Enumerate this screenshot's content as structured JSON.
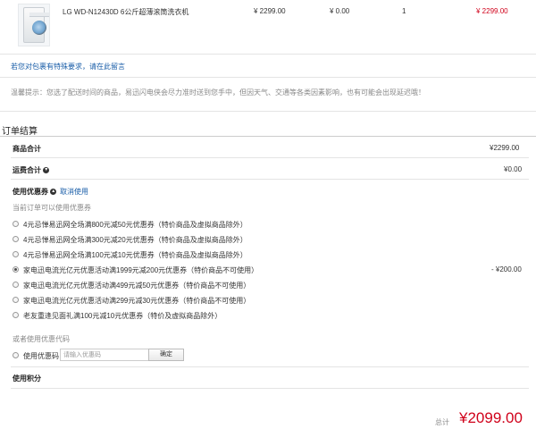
{
  "product": {
    "name": "LG WD-N12430D 6公斤超薄滚筒洗衣机",
    "unit_price": "¥ 2299.00",
    "discount": "¥ 0.00",
    "quantity": "1",
    "subtotal": "¥ 2299.00"
  },
  "packaging_note_link": "若您对包裹有特殊要求，请在此留言",
  "warm_tip": "温馨提示：您选了配送时间的商品，易迅闪电侠会尽力准时送到您手中，但因天气、交通等各类因素影响，也有可能会出现延迟哦！",
  "settlement": {
    "title": "订单结算",
    "goods_total_label": "商品合计",
    "goods_total_value": "¥2299.00",
    "shipping_label": "运费合计",
    "shipping_value": "¥0.00"
  },
  "coupons": {
    "label": "使用优惠券",
    "cancel_link": "取消使用",
    "available_note": "当前订单可以使用优惠券",
    "items": [
      {
        "label": "4元忌惮易迅网全场满800元减50元优惠券（特价商品及虚拟商品除外）",
        "checked": false,
        "amount": ""
      },
      {
        "label": "4元忌惮易迅网全场满300元减20元优惠券（特价商品及虚拟商品除外）",
        "checked": false,
        "amount": ""
      },
      {
        "label": "4元忌惮易迅网全场满100元减10元优惠券（特价商品及虚拟商品除外）",
        "checked": false,
        "amount": ""
      },
      {
        "label": "家电迅电流光亿元优惠活动满1999元减200元优惠券（特价商品不可使用）",
        "checked": true,
        "amount": "- ¥200.00"
      },
      {
        "label": "家电迅电流光亿元优惠活动满499元减50元优惠券（特价商品不可使用）",
        "checked": false,
        "amount": ""
      },
      {
        "label": "家电迅电流光亿元优惠活动满299元减30元优惠券（特价商品不可使用）",
        "checked": false,
        "amount": ""
      },
      {
        "label": "老友重逢见面礼满100元减10元优惠券（特价及虚拟商品除外）",
        "checked": false,
        "amount": ""
      }
    ],
    "or_code_label": "或者使用优惠代码",
    "use_code_label": "使用优惠码",
    "code_placeholder": "请输入优惠码",
    "confirm_label": "确定"
  },
  "points_label": "使用积分",
  "total": {
    "label": "总计",
    "value": "¥2099.00"
  }
}
